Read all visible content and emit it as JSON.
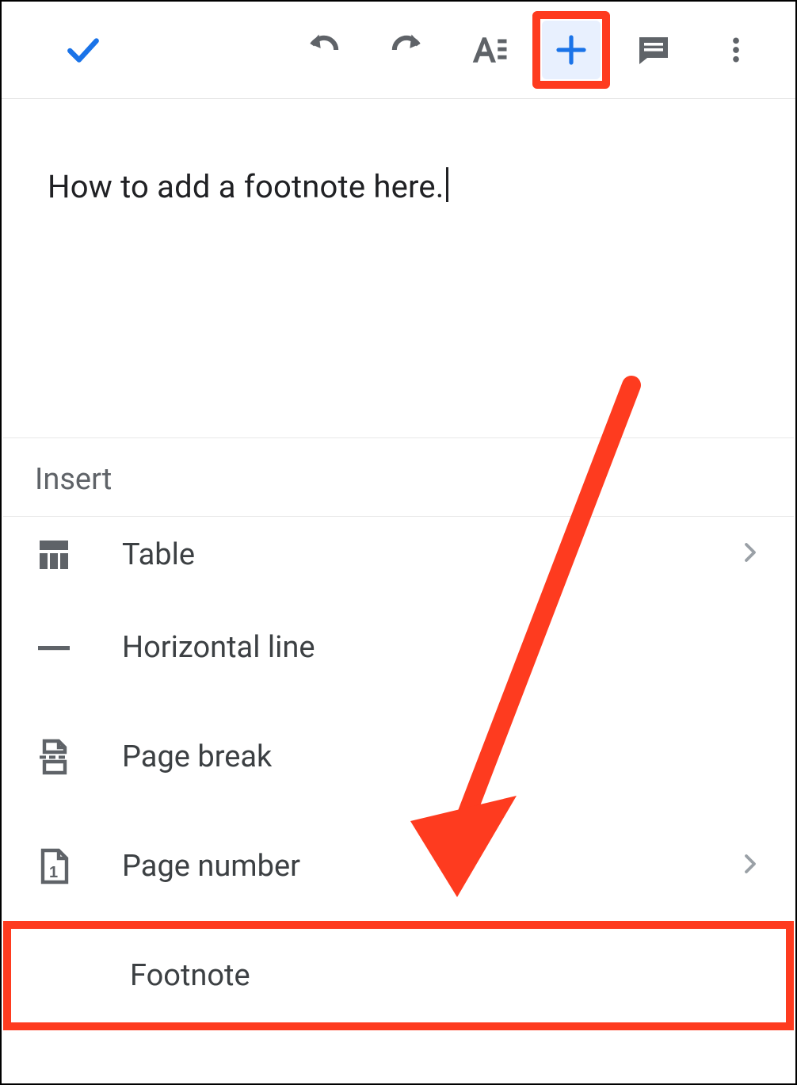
{
  "document": {
    "text": "How to add a footnote here."
  },
  "panel": {
    "title": "Insert",
    "items": [
      {
        "label": "Table",
        "icon": "table-icon",
        "chevron": true
      },
      {
        "label": "Horizontal line",
        "icon": "hline-icon",
        "chevron": false
      },
      {
        "label": "Page break",
        "icon": "pagebreak-icon",
        "chevron": false
      },
      {
        "label": "Page number",
        "icon": "pagenumber-icon",
        "chevron": true
      },
      {
        "label": "Footnote",
        "icon": "footnote-icon",
        "chevron": false
      }
    ]
  },
  "annotations": {
    "highlight_color": "#fe3b1f"
  }
}
